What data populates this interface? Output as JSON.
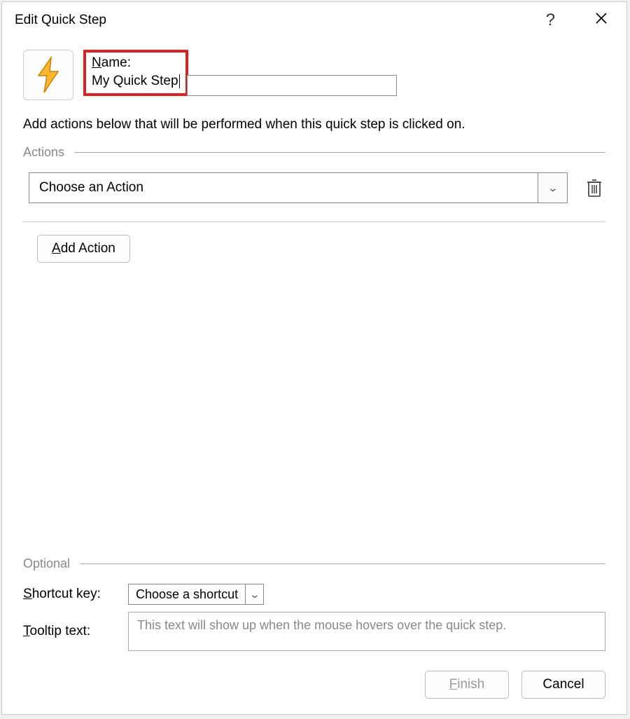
{
  "titlebar": {
    "title": "Edit Quick Step",
    "help": "?",
    "close": "✕"
  },
  "header": {
    "name_label_pre": "N",
    "name_label_post": "ame:",
    "name_value": "My Quick Step"
  },
  "instruction": "Add actions below that will be performed when this quick step is clicked on.",
  "actions": {
    "section_label": "Actions",
    "dropdown_text": "Choose an Action",
    "add_action_pre": "A",
    "add_action_post": "dd Action"
  },
  "optional": {
    "section_label": "Optional",
    "shortcut_label_pre": "S",
    "shortcut_label_post": "hortcut key:",
    "shortcut_value": "Choose a shortcut",
    "tooltip_label_pre": "T",
    "tooltip_label_post": "ooltip text:",
    "tooltip_placeholder": "This text will show up when the mouse hovers over the quick step."
  },
  "buttons": {
    "finish_pre": "F",
    "finish_post": "inish",
    "cancel": "Cancel"
  }
}
